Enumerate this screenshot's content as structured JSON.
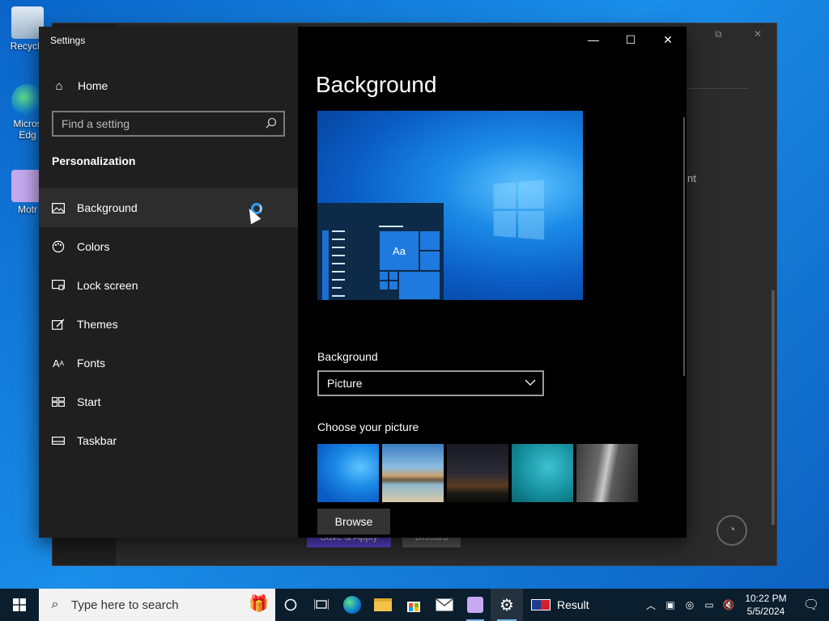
{
  "desktop": {
    "icons": [
      {
        "label": "Recycle"
      },
      {
        "label": "Micros\nEdg"
      },
      {
        "label": "Motr"
      }
    ]
  },
  "background_window": {
    "partial_text": "nt",
    "button1": "Save & Apply",
    "button2": "Discard"
  },
  "settings": {
    "app_title": "Settings",
    "home_label": "Home",
    "search_placeholder": "Find a setting",
    "section_title": "Personalization",
    "nav_items": [
      {
        "label": "Background",
        "icon": "picture-icon",
        "active": true
      },
      {
        "label": "Colors",
        "icon": "palette-icon",
        "active": false
      },
      {
        "label": "Lock screen",
        "icon": "lock-screen-icon",
        "active": false
      },
      {
        "label": "Themes",
        "icon": "themes-icon",
        "active": false
      },
      {
        "label": "Fonts",
        "icon": "fonts-icon",
        "active": false
      },
      {
        "label": "Start",
        "icon": "start-icon",
        "active": false
      },
      {
        "label": "Taskbar",
        "icon": "taskbar-icon",
        "active": false
      }
    ],
    "content": {
      "page_title": "Background",
      "preview_tile_text": "Aa",
      "background_label": "Background",
      "background_value": "Picture",
      "choose_label": "Choose your picture",
      "browse_label": "Browse"
    },
    "window_controls": {
      "minimize": "—",
      "maximize": "☐",
      "close": "✕"
    }
  },
  "taskbar": {
    "search_placeholder": "Type here to search",
    "news_label": "Result",
    "clock_time": "10:22 PM",
    "clock_date": "5/5/2024"
  },
  "colors": {
    "accent": "#0078d7",
    "nav_bg": "#1f1f1f",
    "content_bg": "#000000"
  }
}
